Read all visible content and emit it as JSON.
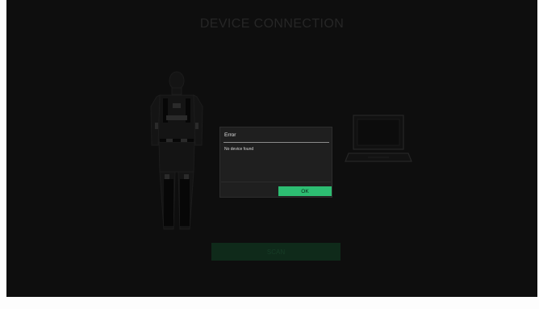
{
  "screen": {
    "title": "DEVICE CONNECTION",
    "scan_button_label": "SCAN"
  },
  "dialog": {
    "title": "Error",
    "message": "No device found",
    "ok_label": "OK"
  },
  "colors": {
    "background": "#0e0e0e",
    "accent_green": "#2dbd72",
    "dialog_bg": "#1f1f1f"
  },
  "icons": [
    "body-suit-icon",
    "laptop-icon"
  ]
}
